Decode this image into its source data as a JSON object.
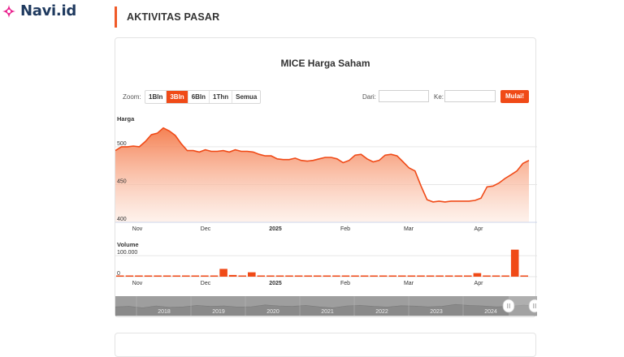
{
  "brand": {
    "name": "Navi.id",
    "logo_icon": "sparkle-icon",
    "color": "#e91e8c"
  },
  "section": {
    "title": "AKTIVITAS PASAR"
  },
  "toolbar": {
    "zoom_label": "Zoom:",
    "zoom_options": [
      "1Bln",
      "3Bln",
      "6Bln",
      "1Thn",
      "Semua"
    ],
    "zoom_selected": "3Bln",
    "from_label": "Dari:",
    "from_value": "",
    "to_label": "Ke:",
    "to_value": "",
    "go_label": "Mulai!"
  },
  "accent_color": "#f04a17",
  "chart_data": {
    "title": "MICE Harga Saham",
    "type": "area",
    "price": {
      "axis_title": "Harga",
      "ylim": [
        400,
        530
      ],
      "yticks": [
        400,
        450,
        500
      ],
      "x_ticks": [
        "Nov",
        "Dec",
        "2025",
        "Feb",
        "Mar",
        "Apr"
      ],
      "x_ticks_bold": [
        "2025"
      ],
      "values": [
        495,
        500,
        500,
        501,
        500,
        507,
        516,
        518,
        525,
        521,
        515,
        504,
        495,
        495,
        493,
        496,
        494,
        494,
        495,
        493,
        496,
        494,
        494,
        493,
        490,
        488,
        488,
        484,
        483,
        483,
        485,
        482,
        481,
        482,
        484,
        486,
        486,
        484,
        479,
        482,
        489,
        490,
        484,
        480,
        482,
        489,
        490,
        488,
        480,
        472,
        468,
        448,
        430,
        427,
        428,
        427,
        428,
        428,
        428,
        428,
        429,
        432,
        447,
        448,
        452,
        458,
        463,
        468,
        478,
        482
      ]
    },
    "volume": {
      "axis_title": "Volume",
      "yticks_labels": [
        "0",
        "100.000"
      ],
      "ylim": [
        0,
        120000
      ],
      "x_ticks": [
        "Nov",
        "Dec",
        "2025",
        "Feb",
        "Mar",
        "Apr"
      ],
      "x_ticks_bold": [
        "2025"
      ],
      "values": [
        3000,
        1500,
        2000,
        1500,
        1000,
        1200,
        1000,
        1500,
        1200,
        1000,
        2000,
        37000,
        8000,
        2000,
        21000,
        1500,
        1200,
        1000,
        1500,
        1000,
        1200,
        1000,
        1500,
        1000,
        1000,
        1000,
        1500,
        1200,
        2500,
        1000,
        1200,
        1000,
        1000,
        1000,
        3500,
        3000,
        4000,
        2000,
        17000,
        3000,
        1500,
        1000,
        129000,
        1000
      ]
    },
    "navigator": {
      "years": [
        "2018",
        "2019",
        "2020",
        "2021",
        "2022",
        "2023",
        "2024"
      ]
    }
  }
}
